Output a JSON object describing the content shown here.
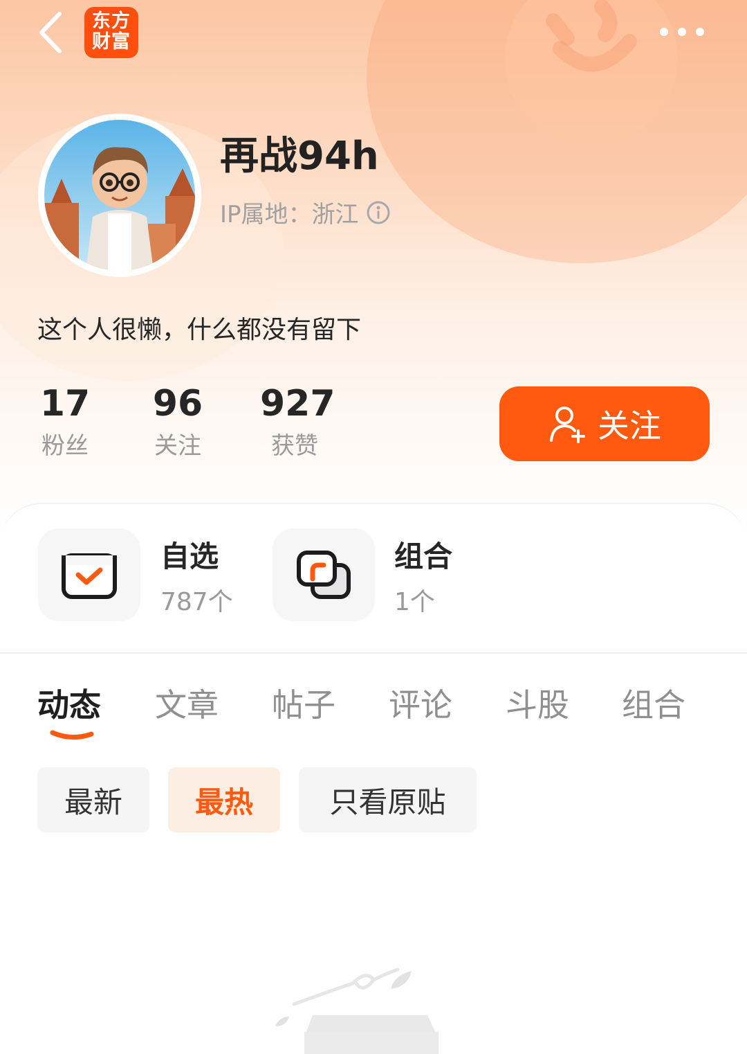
{
  "app": {
    "logo_line1": "东方",
    "logo_line2": "财富",
    "brand_color": "#ff5a0f"
  },
  "profile": {
    "username": "再战94h",
    "ip_location": "IP属地：浙江",
    "bio": "这个人很懒，什么都没有留下"
  },
  "stats": [
    {
      "value": "17",
      "label": "粉丝"
    },
    {
      "value": "96",
      "label": "关注"
    },
    {
      "value": "927",
      "label": "获赞"
    }
  ],
  "follow_button": {
    "label": "关注"
  },
  "assets": [
    {
      "title": "自选",
      "count": "787个",
      "icon": "checkbox-icon"
    },
    {
      "title": "组合",
      "count": "1个",
      "icon": "portfolio-icon"
    }
  ],
  "tabs": [
    "动态",
    "文章",
    "帖子",
    "评论",
    "斗股",
    "组合"
  ],
  "active_tab": "动态",
  "filters": [
    "最新",
    "最热",
    "只看原贴"
  ],
  "active_filter": "最热"
}
